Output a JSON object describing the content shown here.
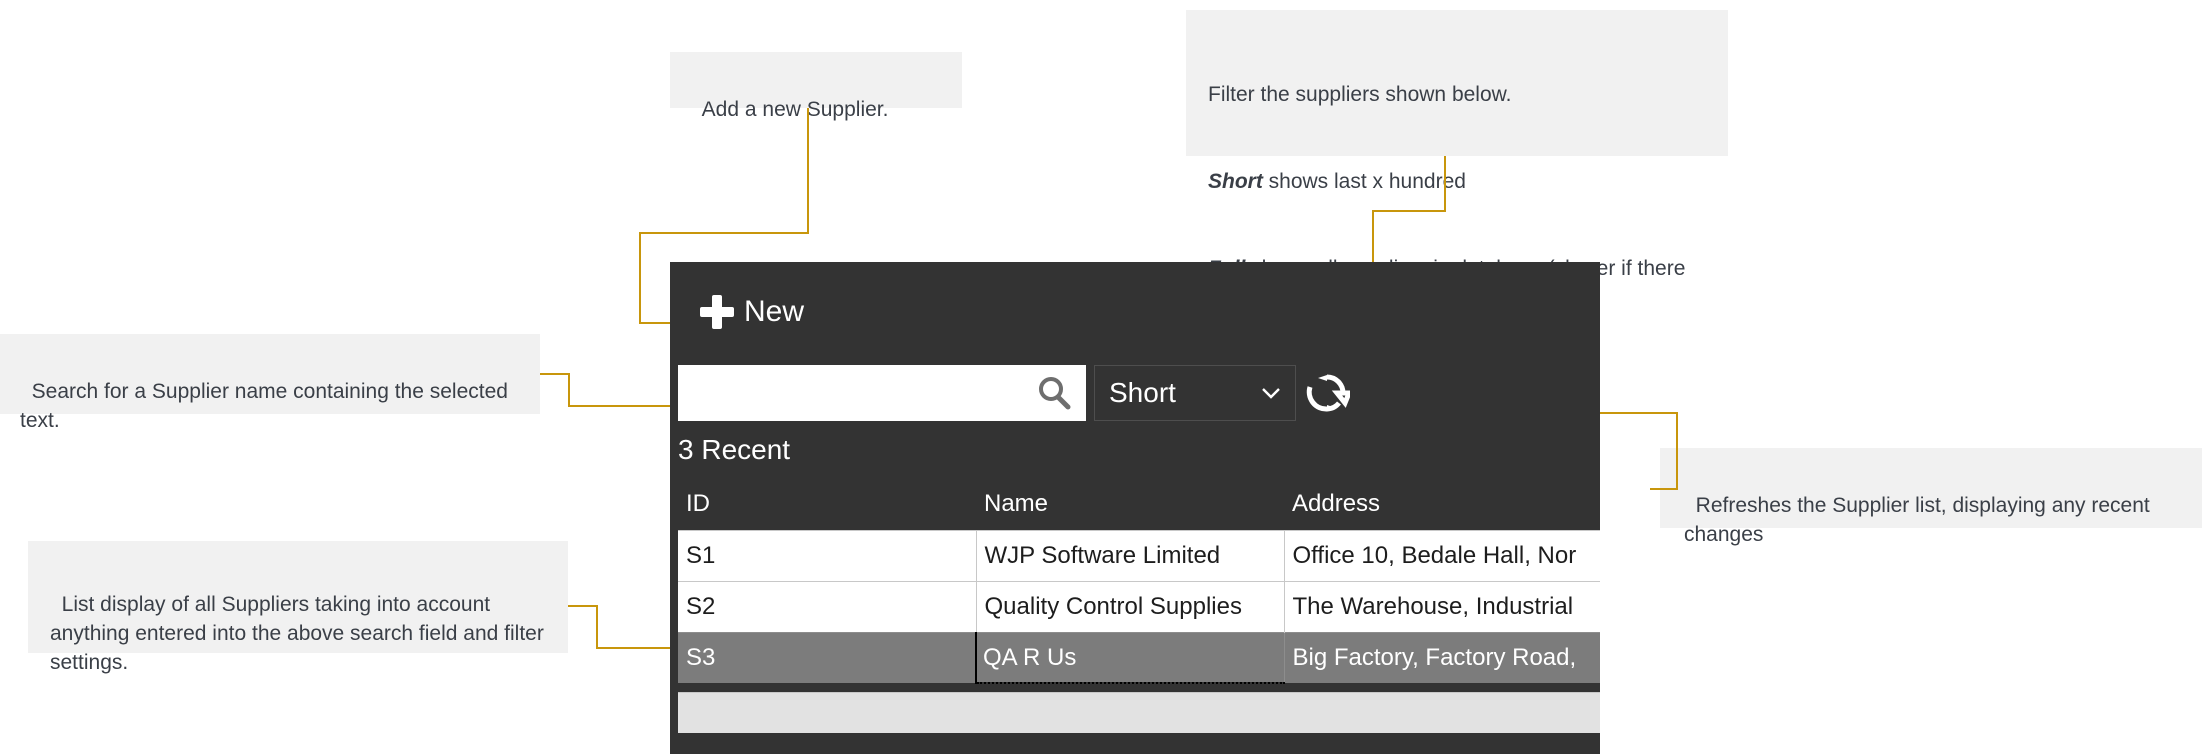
{
  "annotations": {
    "new_button": {
      "text": "Add a new Supplier."
    },
    "filter": {
      "line1": "Filter the suppliers shown below.",
      "short_label": "Short",
      "line2_rest": " shows last x hundred",
      "full_label": "Full",
      "line3_rest": " shows all suppliers in database (slower if there are many suppliers)"
    },
    "search": {
      "text": "Search for a Supplier name containing the selected text."
    },
    "list": {
      "text": "List display of all Suppliers taking into account anything entered into the above search field and filter settings."
    },
    "refresh": {
      "text": "Refreshes the Supplier list, displaying any recent changes"
    }
  },
  "app": {
    "new_button_label": "New",
    "search": {
      "value": "",
      "placeholder": ""
    },
    "filter": {
      "selected": "Short",
      "options": [
        "Short",
        "Full"
      ]
    },
    "recent_label": "3 Recent",
    "table": {
      "columns": [
        "ID",
        "Name",
        "Address"
      ],
      "rows": [
        {
          "id": "S1",
          "name": "WJP Software Limited",
          "address": "Office 10, Bedale Hall, Nor",
          "selected": false
        },
        {
          "id": "S2",
          "name": "Quality Control Supplies",
          "address": "The Warehouse, Industrial",
          "selected": false
        },
        {
          "id": "S3",
          "name": "QA R Us",
          "address": "Big Factory, Factory Road,",
          "selected": true
        }
      ]
    }
  },
  "colors": {
    "leader": "#c8960c",
    "panel_background": "#333333",
    "callout_background": "#f1f1f1",
    "selection": "#7c7c7c"
  }
}
